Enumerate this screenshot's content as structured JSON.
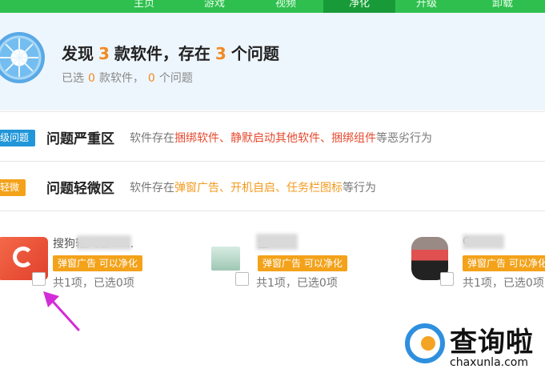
{
  "nav": {
    "tabs": [
      {
        "label": "主页"
      },
      {
        "label": "游戏"
      },
      {
        "label": "视频"
      },
      {
        "label": "净化"
      },
      {
        "label": "升级"
      },
      {
        "label": "卸载"
      }
    ],
    "active_index": 3
  },
  "summary": {
    "found_prefix": "发现",
    "found_count": "3",
    "found_mid": "款软件，存在",
    "issue_count": "3",
    "found_suffix": "个问题",
    "selected_prefix": "已选",
    "selected_software": "0",
    "selected_mid": "款软件，",
    "selected_issues": "0",
    "selected_suffix": "个问题"
  },
  "severe": {
    "badge": "级问题",
    "title": "问题严重区",
    "desc_prefix": "软件存在",
    "desc_highlight": "捆绑软件、静默启动其他软件、捆绑组件",
    "desc_suffix": "等恶劣行为"
  },
  "minor": {
    "badge": "轻微",
    "title": "问题轻微区",
    "desc_prefix": "软件存在",
    "desc_highlight": "弹窗广告、开机自启、任务栏图标",
    "desc_suffix": "等行为"
  },
  "software": [
    {
      "name": "搜狗输入法 .0...",
      "tag": "弹窗广告 可以净化",
      "count": "共1项，已选0项"
    },
    {
      "name": "堂",
      "tag": "弹窗广告 可以净化",
      "count": "共1项，已选0项"
    },
    {
      "name": "Q",
      "tag": "弹窗广告 可以净化",
      "count": "共1项，已选0项"
    }
  ],
  "watermark": {
    "text": "查询啦",
    "url": "chaxunla.com"
  },
  "colors": {
    "nav_green": "#2fbf4f",
    "highlight_orange": "#f08a24",
    "severe_red": "#e64a2e",
    "badge_blue": "#2196d9",
    "tag_orange": "#f3a21a",
    "annotation_magenta": "#d42bd8"
  }
}
